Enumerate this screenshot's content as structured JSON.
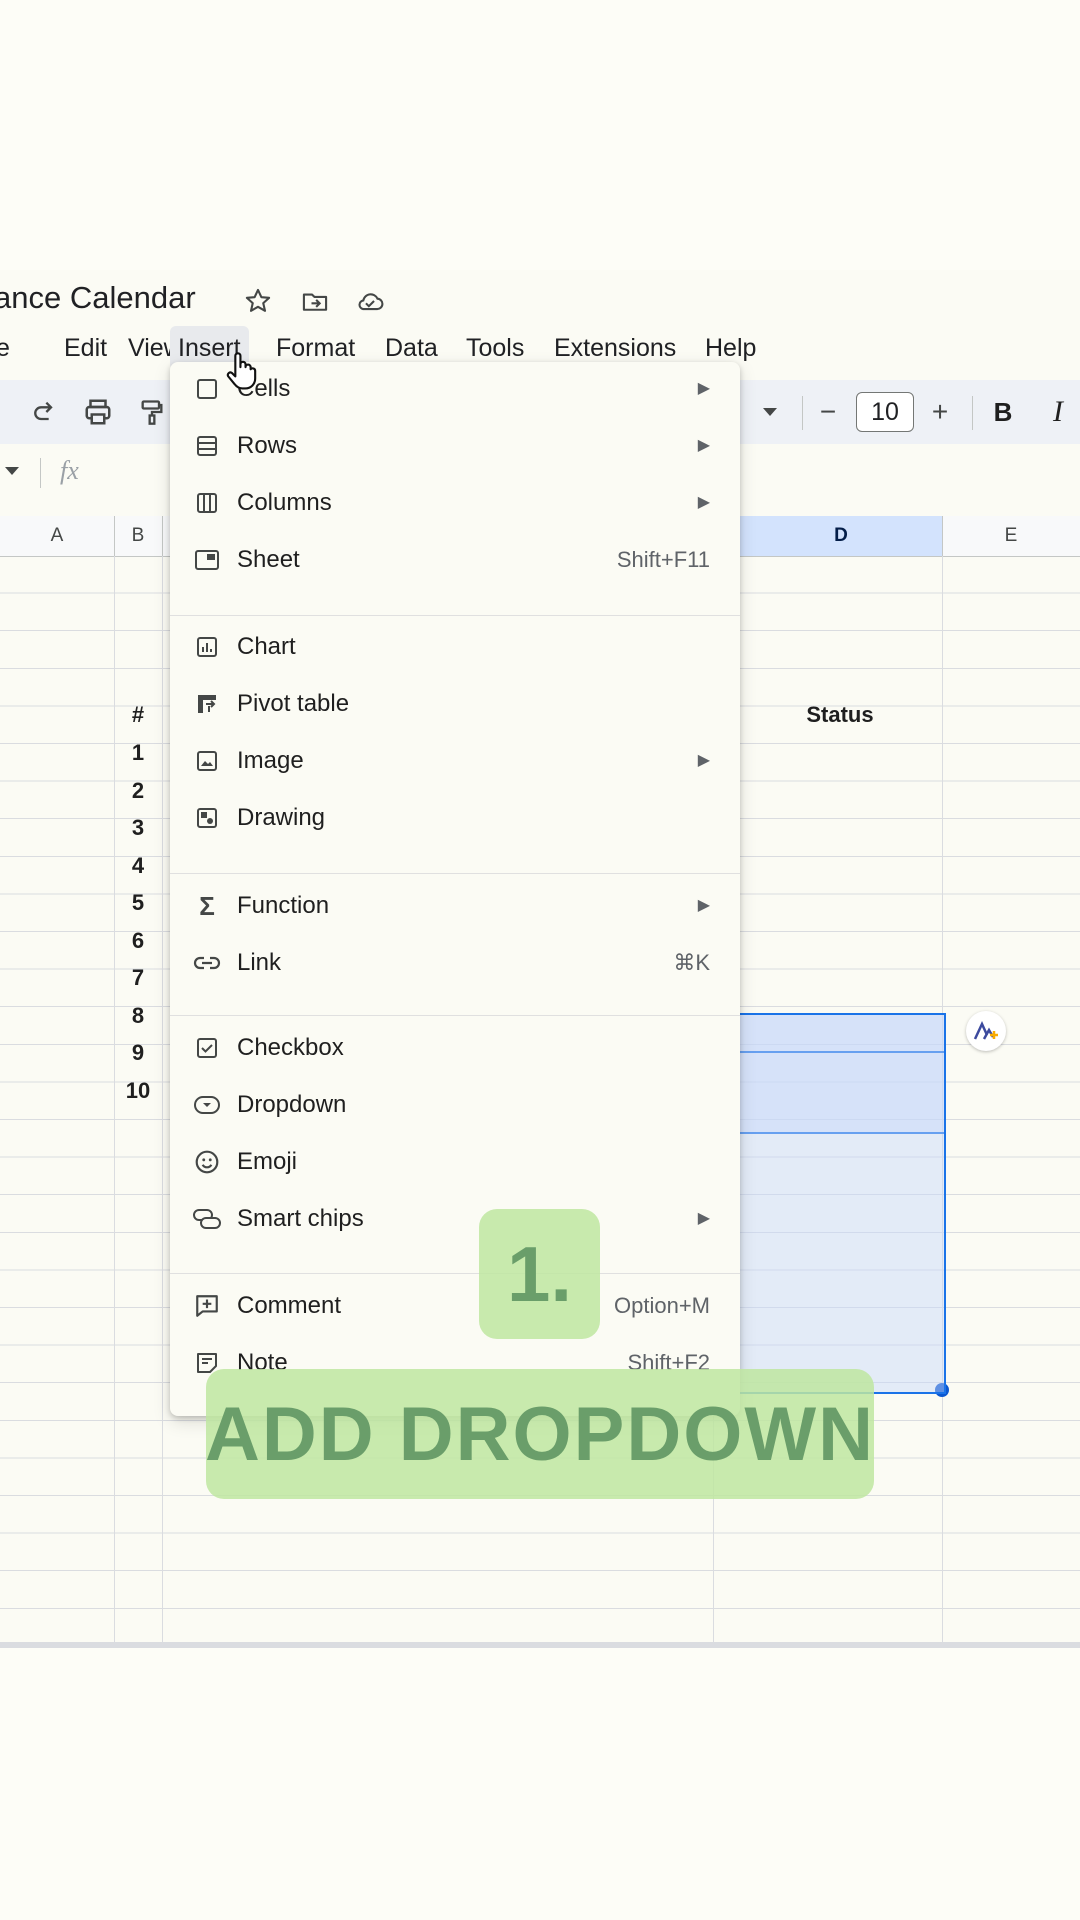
{
  "document": {
    "title": "ance Calendar"
  },
  "title_icons": [
    "star-icon",
    "move-to-folder-icon",
    "cloud-saved-icon"
  ],
  "menubar": {
    "items": [
      "e",
      "Edit",
      "View",
      "Insert",
      "Format",
      "Data",
      "Tools",
      "Extensions",
      "Help"
    ],
    "active": "Insert"
  },
  "toolbar": {
    "icons": [
      "redo-icon",
      "print-icon",
      "paint-format-icon",
      "font-size-dropdown-icon",
      "decrease-font-size-icon",
      "increase-font-size-icon",
      "bold-icon",
      "italic-icon"
    ],
    "font_size": "10",
    "minus": "−",
    "plus": "+",
    "bold": "B",
    "italic": "I"
  },
  "formula_bar": {
    "fx": "fx"
  },
  "columns": [
    "A",
    "B",
    "D",
    "E"
  ],
  "selected_column": "D",
  "sheet": {
    "hash_header": "#",
    "status_header": "Status",
    "row_numbers": [
      "1",
      "2",
      "3",
      "4",
      "5",
      "6",
      "7",
      "8",
      "9",
      "10"
    ]
  },
  "insert_menu": {
    "groups": [
      [
        {
          "icon": "cells-icon",
          "label": "Cells",
          "submenu": true
        },
        {
          "icon": "rows-icon",
          "label": "Rows",
          "submenu": true
        },
        {
          "icon": "columns-icon",
          "label": "Columns",
          "submenu": true
        },
        {
          "icon": "sheet-icon",
          "label": "Sheet",
          "shortcut": "Shift+F11"
        }
      ],
      [
        {
          "icon": "chart-icon",
          "label": "Chart"
        },
        {
          "icon": "pivot-table-icon",
          "label": "Pivot table"
        },
        {
          "icon": "image-icon",
          "label": "Image",
          "submenu": true
        },
        {
          "icon": "drawing-icon",
          "label": "Drawing"
        }
      ],
      [
        {
          "icon": "function-icon",
          "label": "Function",
          "submenu": true
        },
        {
          "icon": "link-icon",
          "label": "Link",
          "shortcut": "⌘K"
        }
      ],
      [
        {
          "icon": "checkbox-icon",
          "label": "Checkbox"
        },
        {
          "icon": "dropdown-icon",
          "label": "Dropdown"
        },
        {
          "icon": "emoji-icon",
          "label": "Emoji"
        },
        {
          "icon": "smart-chips-icon",
          "label": "Smart chips",
          "submenu": true
        }
      ],
      [
        {
          "icon": "comment-icon",
          "label": "Comment",
          "shortcut": "Option+M"
        },
        {
          "icon": "note-icon",
          "label": "Note",
          "shortcut": "Shift+F2"
        }
      ]
    ],
    "submenu_arrow": "▶"
  },
  "overlay": {
    "step": "1.",
    "caption": "ADD DROPDOWN"
  },
  "colors": {
    "selection_border": "#1a73e8",
    "selection_fill": "#c6d8fa",
    "overlay_green": "#bee6a0",
    "overlay_text": "#6a9e6a"
  }
}
